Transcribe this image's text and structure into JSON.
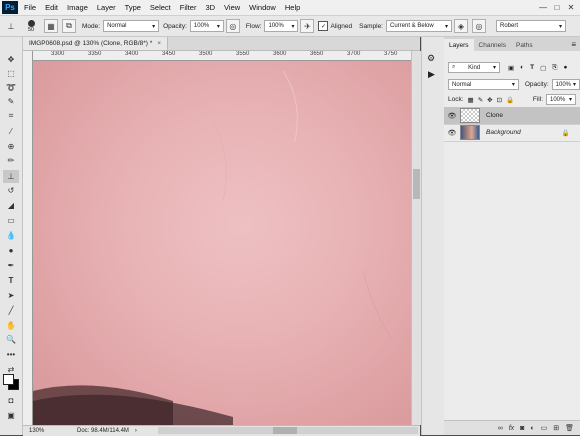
{
  "app": {
    "logo": "Ps"
  },
  "menu": [
    "File",
    "Edit",
    "Image",
    "Layer",
    "Type",
    "Select",
    "Filter",
    "3D",
    "View",
    "Window",
    "Help"
  ],
  "window_controls": [
    "—",
    "□",
    "✕"
  ],
  "options": {
    "brush_size": "50",
    "mode_label": "Mode:",
    "mode_value": "Normal",
    "opacity_label": "Opacity:",
    "opacity_value": "100%",
    "flow_label": "Flow:",
    "flow_value": "100%",
    "aligned_label": "Aligned",
    "aligned_checked": true,
    "sample_label": "Sample:",
    "sample_value": "Current & Below",
    "workspace_value": "Robert"
  },
  "document": {
    "tab_title": "IMGP0608.psd @ 130% (Clone, RGB/8*) *",
    "close": "×",
    "ruler_labels": [
      "3300",
      "3350",
      "3400",
      "3450",
      "3500",
      "3550",
      "3600",
      "3650",
      "3700",
      "3750"
    ],
    "zoom": "130%",
    "doc_info": "Doc: 98.4M/114.4M"
  },
  "layers_panel": {
    "tabs": [
      "Layers",
      "Channels",
      "Paths"
    ],
    "filter_label": "Kind",
    "blend_mode": "Normal",
    "opacity_label": "Opacity:",
    "opacity_value": "100%",
    "lock_label": "Lock:",
    "fill_label": "Fill:",
    "fill_value": "100%",
    "layers": [
      {
        "name": "Clone",
        "selected": true,
        "visible": true,
        "locked": false
      },
      {
        "name": "Background",
        "selected": false,
        "visible": true,
        "locked": true
      }
    ],
    "footer_icons": [
      "link-icon",
      "fx-icon",
      "mask-icon",
      "adjustment-icon",
      "group-icon",
      "new-layer-icon",
      "trash-icon"
    ]
  },
  "colors": {
    "accent": "#31a8ff",
    "canvas": "#e8b3b5",
    "selected_layer": "#c3c3c3"
  }
}
